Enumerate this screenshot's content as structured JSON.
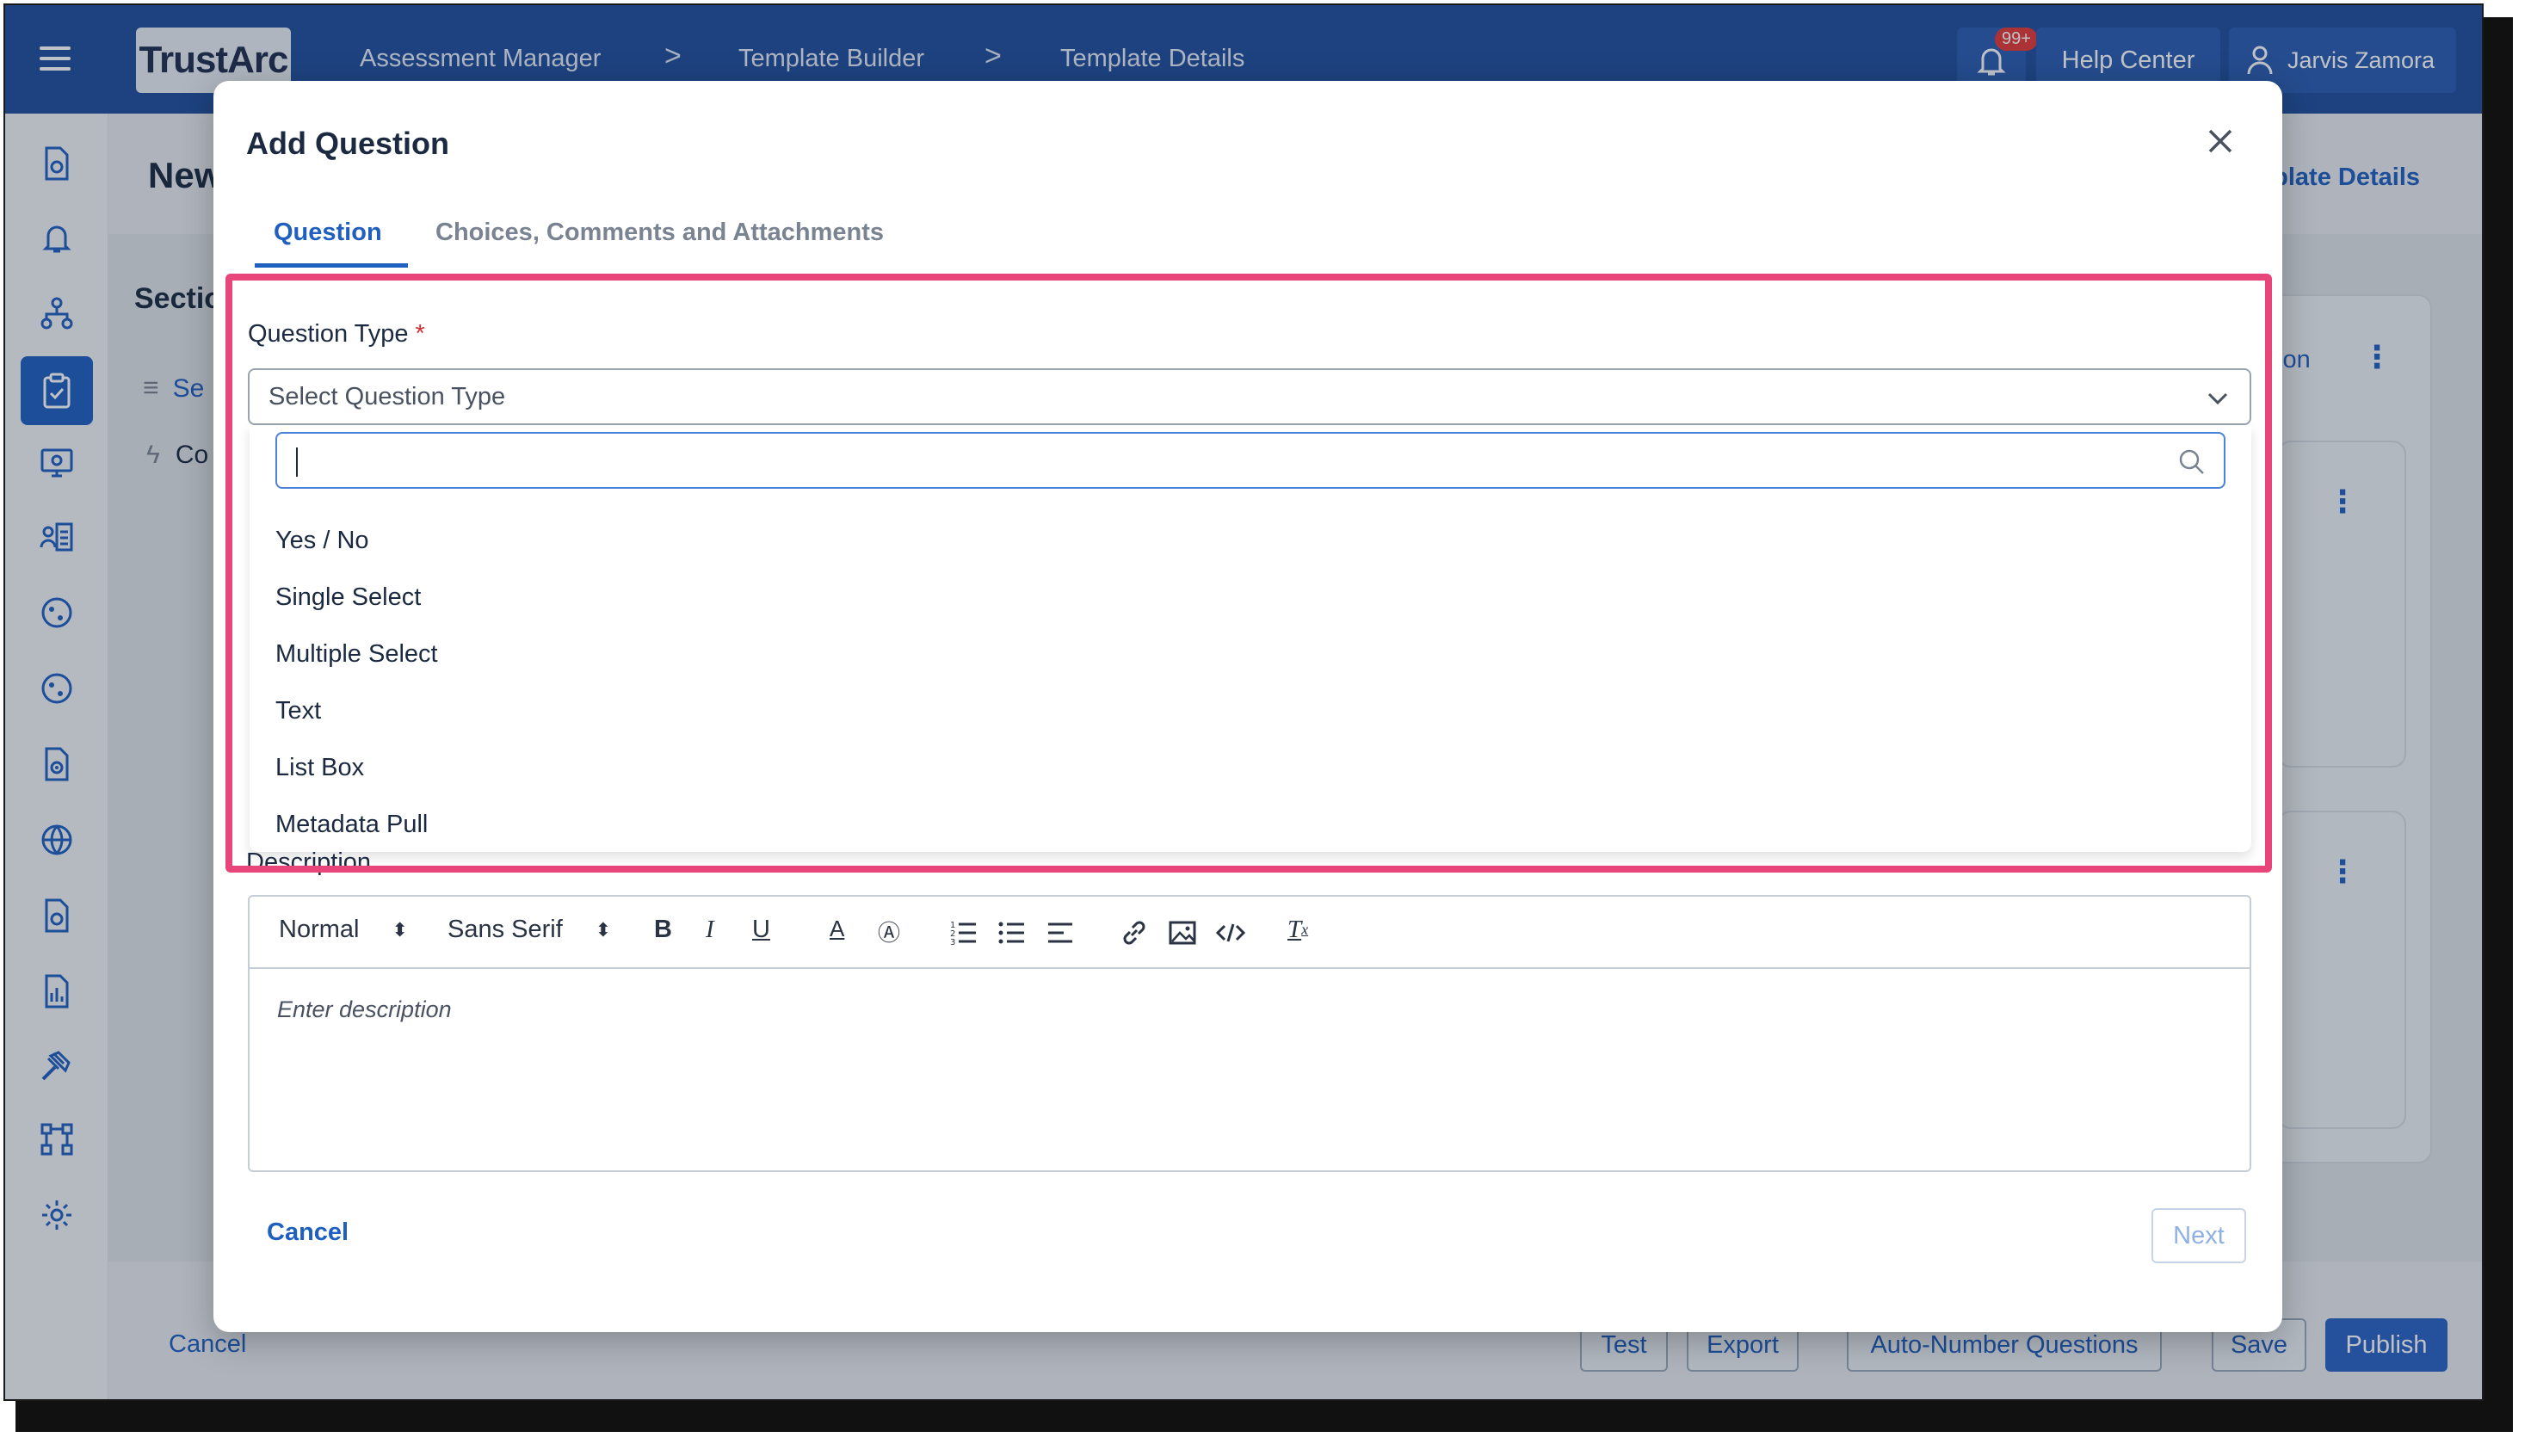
{
  "header": {
    "logo_text": "TrustArc",
    "breadcrumbs": [
      "Assessment Manager",
      "Template Builder",
      "Template Details"
    ],
    "breadcrumb_separator": ">",
    "notification_badge": "99+",
    "help_label": "Help Center",
    "user_name": "Jarvis Zamora",
    "colors": {
      "bar": "#1f4e9c",
      "accent": "#1f5fbf"
    }
  },
  "sidebar": {
    "icons": [
      "document-search-icon",
      "bell-icon",
      "hierarchy-icon",
      "clipboard-check-icon",
      "monitor-icon",
      "contacts-icon",
      "globe-cookie-icon",
      "globe-cookie-icon",
      "document-target-icon",
      "globe-icon",
      "document-search-icon",
      "report-icon",
      "gavel-icon",
      "workflow-icon",
      "gear-icon"
    ],
    "active_index": 3
  },
  "background": {
    "page_title": "New",
    "template_details_link": "plate Details",
    "sections_label": "Sectio",
    "section_item_1": "Se",
    "section_item_2": "Co",
    "card_link": "ion",
    "footer": {
      "cancel": "Cancel",
      "test": "Test",
      "export": "Export",
      "auto_number": "Auto-Number Questions",
      "save": "Save",
      "publish": "Publish"
    }
  },
  "modal": {
    "title": "Add Question",
    "tabs": [
      "Question",
      "Choices, Comments and Attachments"
    ],
    "active_tab": "Question",
    "question_type": {
      "label": "Question Type",
      "required_marker": "*",
      "placeholder": "Select Question Type",
      "search_value": "",
      "options": [
        "Yes / No",
        "Single Select",
        "Multiple Select",
        "Text",
        "List Box",
        "Metadata Pull"
      ]
    },
    "description": {
      "label": "Description",
      "toolbar": {
        "heading": "Normal",
        "font": "Sans Serif"
      },
      "placeholder": "Enter description"
    },
    "cancel_label": "Cancel",
    "next_label": "Next",
    "highlight_color": "#e8457a"
  }
}
